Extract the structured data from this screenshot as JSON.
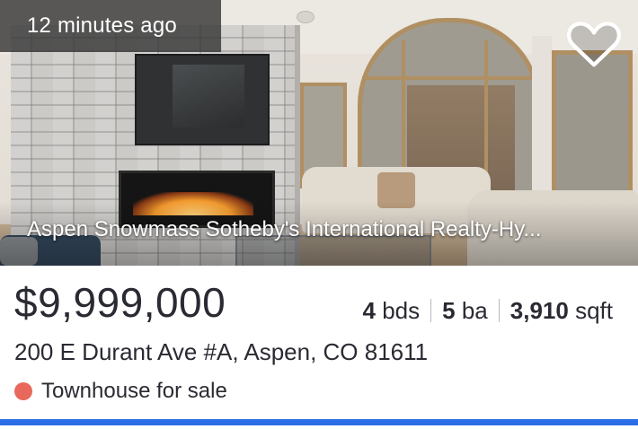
{
  "listing": {
    "time_ago": "12 minutes ago",
    "broker": "Aspen Snowmass Sotheby's International Realty-Hy...",
    "price": "$9,999,000",
    "beds_value": "4",
    "beds_unit": "bds",
    "baths_value": "5",
    "baths_unit": "ba",
    "sqft_value": "3,910",
    "sqft_unit": "sqft",
    "address": "200 E Durant Ave #A, Aspen, CO 81611",
    "status": "Townhouse for sale",
    "favorite_icon": "heart-outline-icon"
  },
  "colors": {
    "status_dot": "#e8695b",
    "accent_bar": "#2b6fe6",
    "text": "#2a2a33"
  }
}
